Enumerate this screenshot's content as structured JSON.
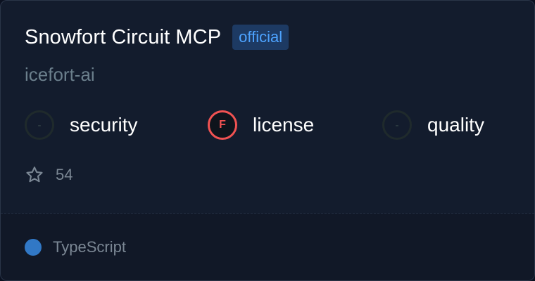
{
  "server": {
    "name": "Snowfort Circuit MCP",
    "badge": "official",
    "owner": "icefort-ai"
  },
  "scores": [
    {
      "label": "security",
      "grade": "-",
      "status": "none"
    },
    {
      "label": "license",
      "grade": "F",
      "status": "fail"
    },
    {
      "label": "quality",
      "grade": "-",
      "status": "none"
    }
  ],
  "stars": {
    "icon": "star-outline-icon",
    "count": "54"
  },
  "language": {
    "name": "TypeScript",
    "color": "#3178c6"
  },
  "colors": {
    "card_background": "#131c2d",
    "footer_background": "#111827",
    "badge_background": "#1d3a63",
    "badge_text": "#4da3ff",
    "fail_red": "#f05252",
    "muted_text": "#7b8794"
  }
}
